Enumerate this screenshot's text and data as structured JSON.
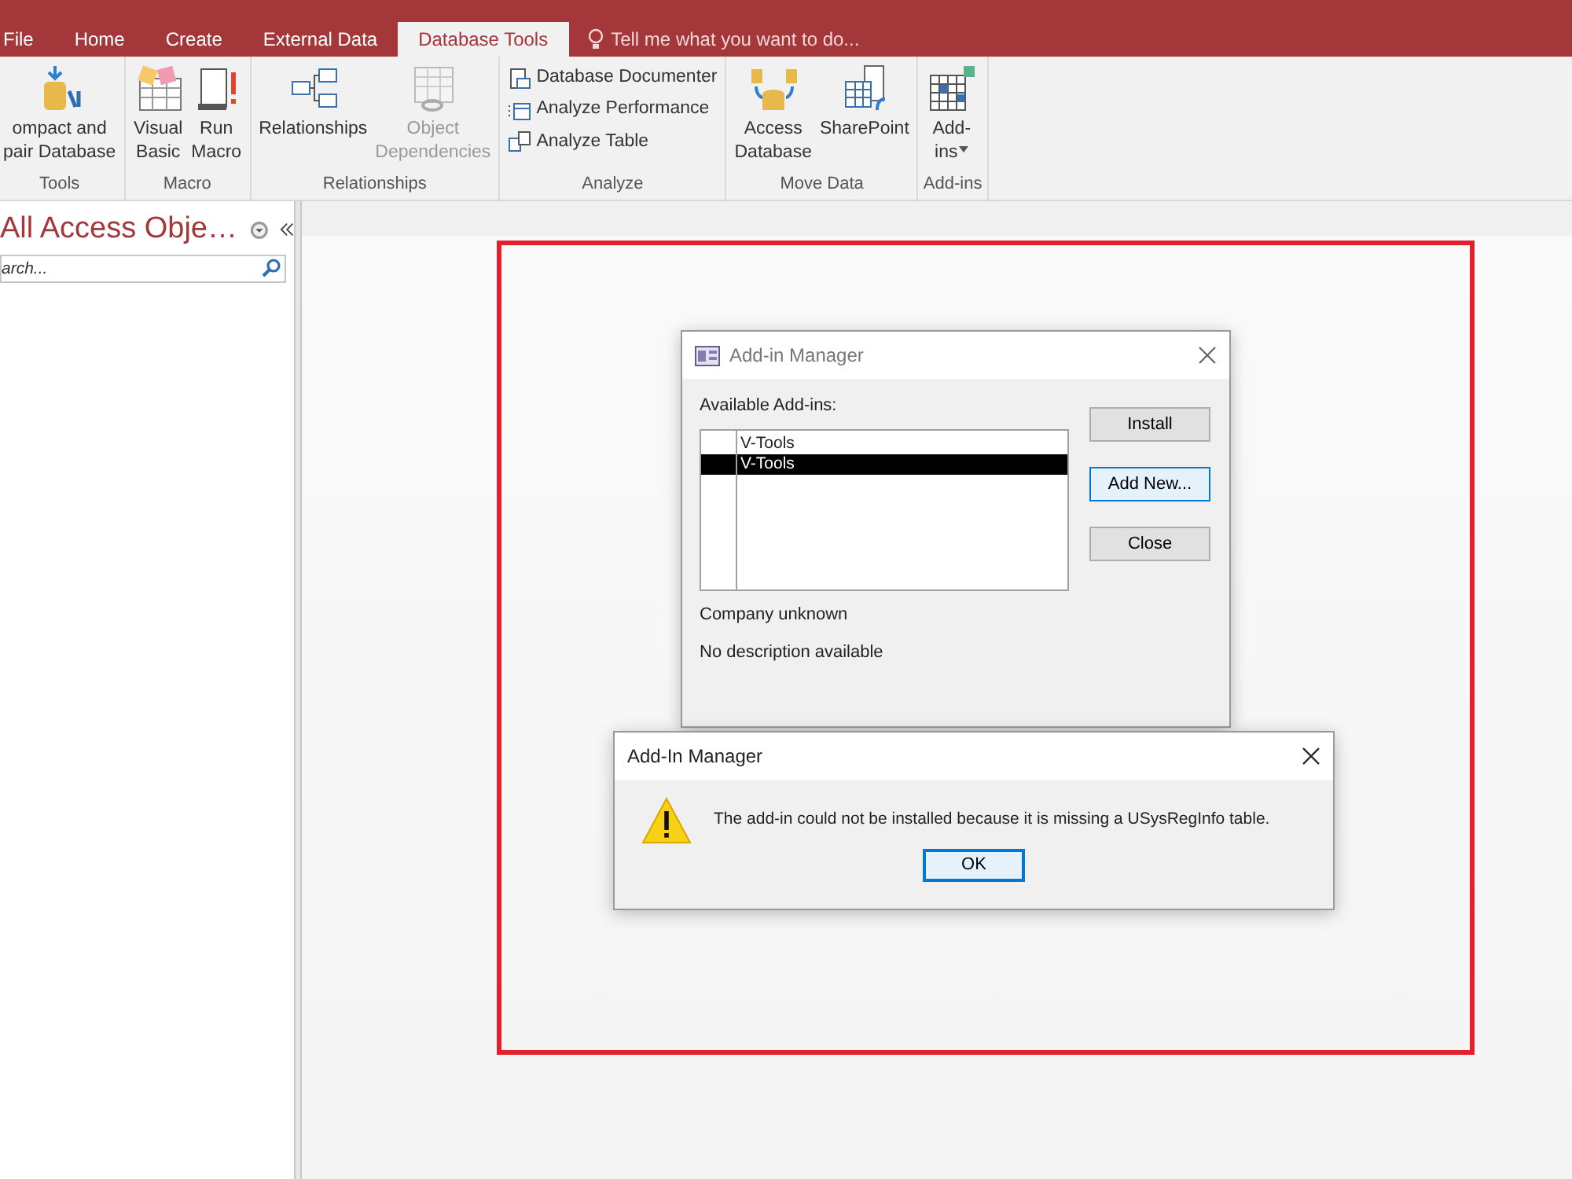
{
  "ribbon_tabs": [
    {
      "label": "File",
      "selected": false
    },
    {
      "label": "Home",
      "selected": false
    },
    {
      "label": "Create",
      "selected": false
    },
    {
      "label": "External Data",
      "selected": false
    },
    {
      "label": "Database Tools",
      "selected": true
    }
  ],
  "tell_me": {
    "placeholder": "Tell me what you want to do..."
  },
  "ribbon_groups": [
    {
      "label": "Tools",
      "buttons": [
        {
          "kind": "large",
          "lines": [
            "ompact and",
            "pair Database"
          ],
          "disabled": false,
          "dropdown": false
        }
      ]
    },
    {
      "label": "Macro",
      "buttons": [
        {
          "kind": "large",
          "lines": [
            "Visual",
            "Basic"
          ],
          "disabled": false,
          "dropdown": false
        },
        {
          "kind": "large",
          "lines": [
            "Run",
            "Macro"
          ],
          "disabled": false,
          "dropdown": false
        }
      ]
    },
    {
      "label": "Relationships",
      "buttons": [
        {
          "kind": "large",
          "lines": [
            "Relationships"
          ],
          "disabled": false,
          "dropdown": false
        },
        {
          "kind": "large",
          "lines": [
            "Object",
            "Dependencies"
          ],
          "disabled": true,
          "dropdown": false
        }
      ]
    },
    {
      "label": "Analyze",
      "buttons": [
        {
          "kind": "small",
          "lines": [
            "Database Documenter"
          ],
          "disabled": false,
          "dropdown": false
        },
        {
          "kind": "small",
          "lines": [
            "Analyze Performance"
          ],
          "disabled": false,
          "dropdown": false
        },
        {
          "kind": "small",
          "lines": [
            "Analyze Table"
          ],
          "disabled": false,
          "dropdown": false
        }
      ]
    },
    {
      "label": "Move Data",
      "buttons": [
        {
          "kind": "large",
          "lines": [
            "Access",
            "Database"
          ],
          "disabled": false,
          "dropdown": false
        },
        {
          "kind": "large",
          "lines": [
            "SharePoint"
          ],
          "disabled": false,
          "dropdown": false
        }
      ]
    },
    {
      "label": "Add-ins",
      "buttons": [
        {
          "kind": "large",
          "lines": [
            "Add-",
            "ins"
          ],
          "disabled": false,
          "dropdown": true
        }
      ]
    }
  ],
  "nav_pane": {
    "title": "All Access Obje…",
    "search": {
      "placeholder": "arch..."
    }
  },
  "add_in_manager": {
    "title": "Add-in Manager",
    "list_label": "Available Add-ins:",
    "items": [
      {
        "label": "V-Tools",
        "selected": false
      },
      {
        "label": "V-Tools",
        "selected": true
      }
    ],
    "buttons": [
      {
        "label": "Install",
        "focused": false
      },
      {
        "label": "Add New...",
        "focused": true
      },
      {
        "label": "Close",
        "focused": false
      }
    ],
    "company": "Company unknown",
    "description": "No description available"
  },
  "error_dialog": {
    "title": "Add-In Manager",
    "message": "The add-in could not be installed because it is missing a USysRegInfo table.",
    "button": {
      "label": "OK",
      "focused": true
    }
  }
}
